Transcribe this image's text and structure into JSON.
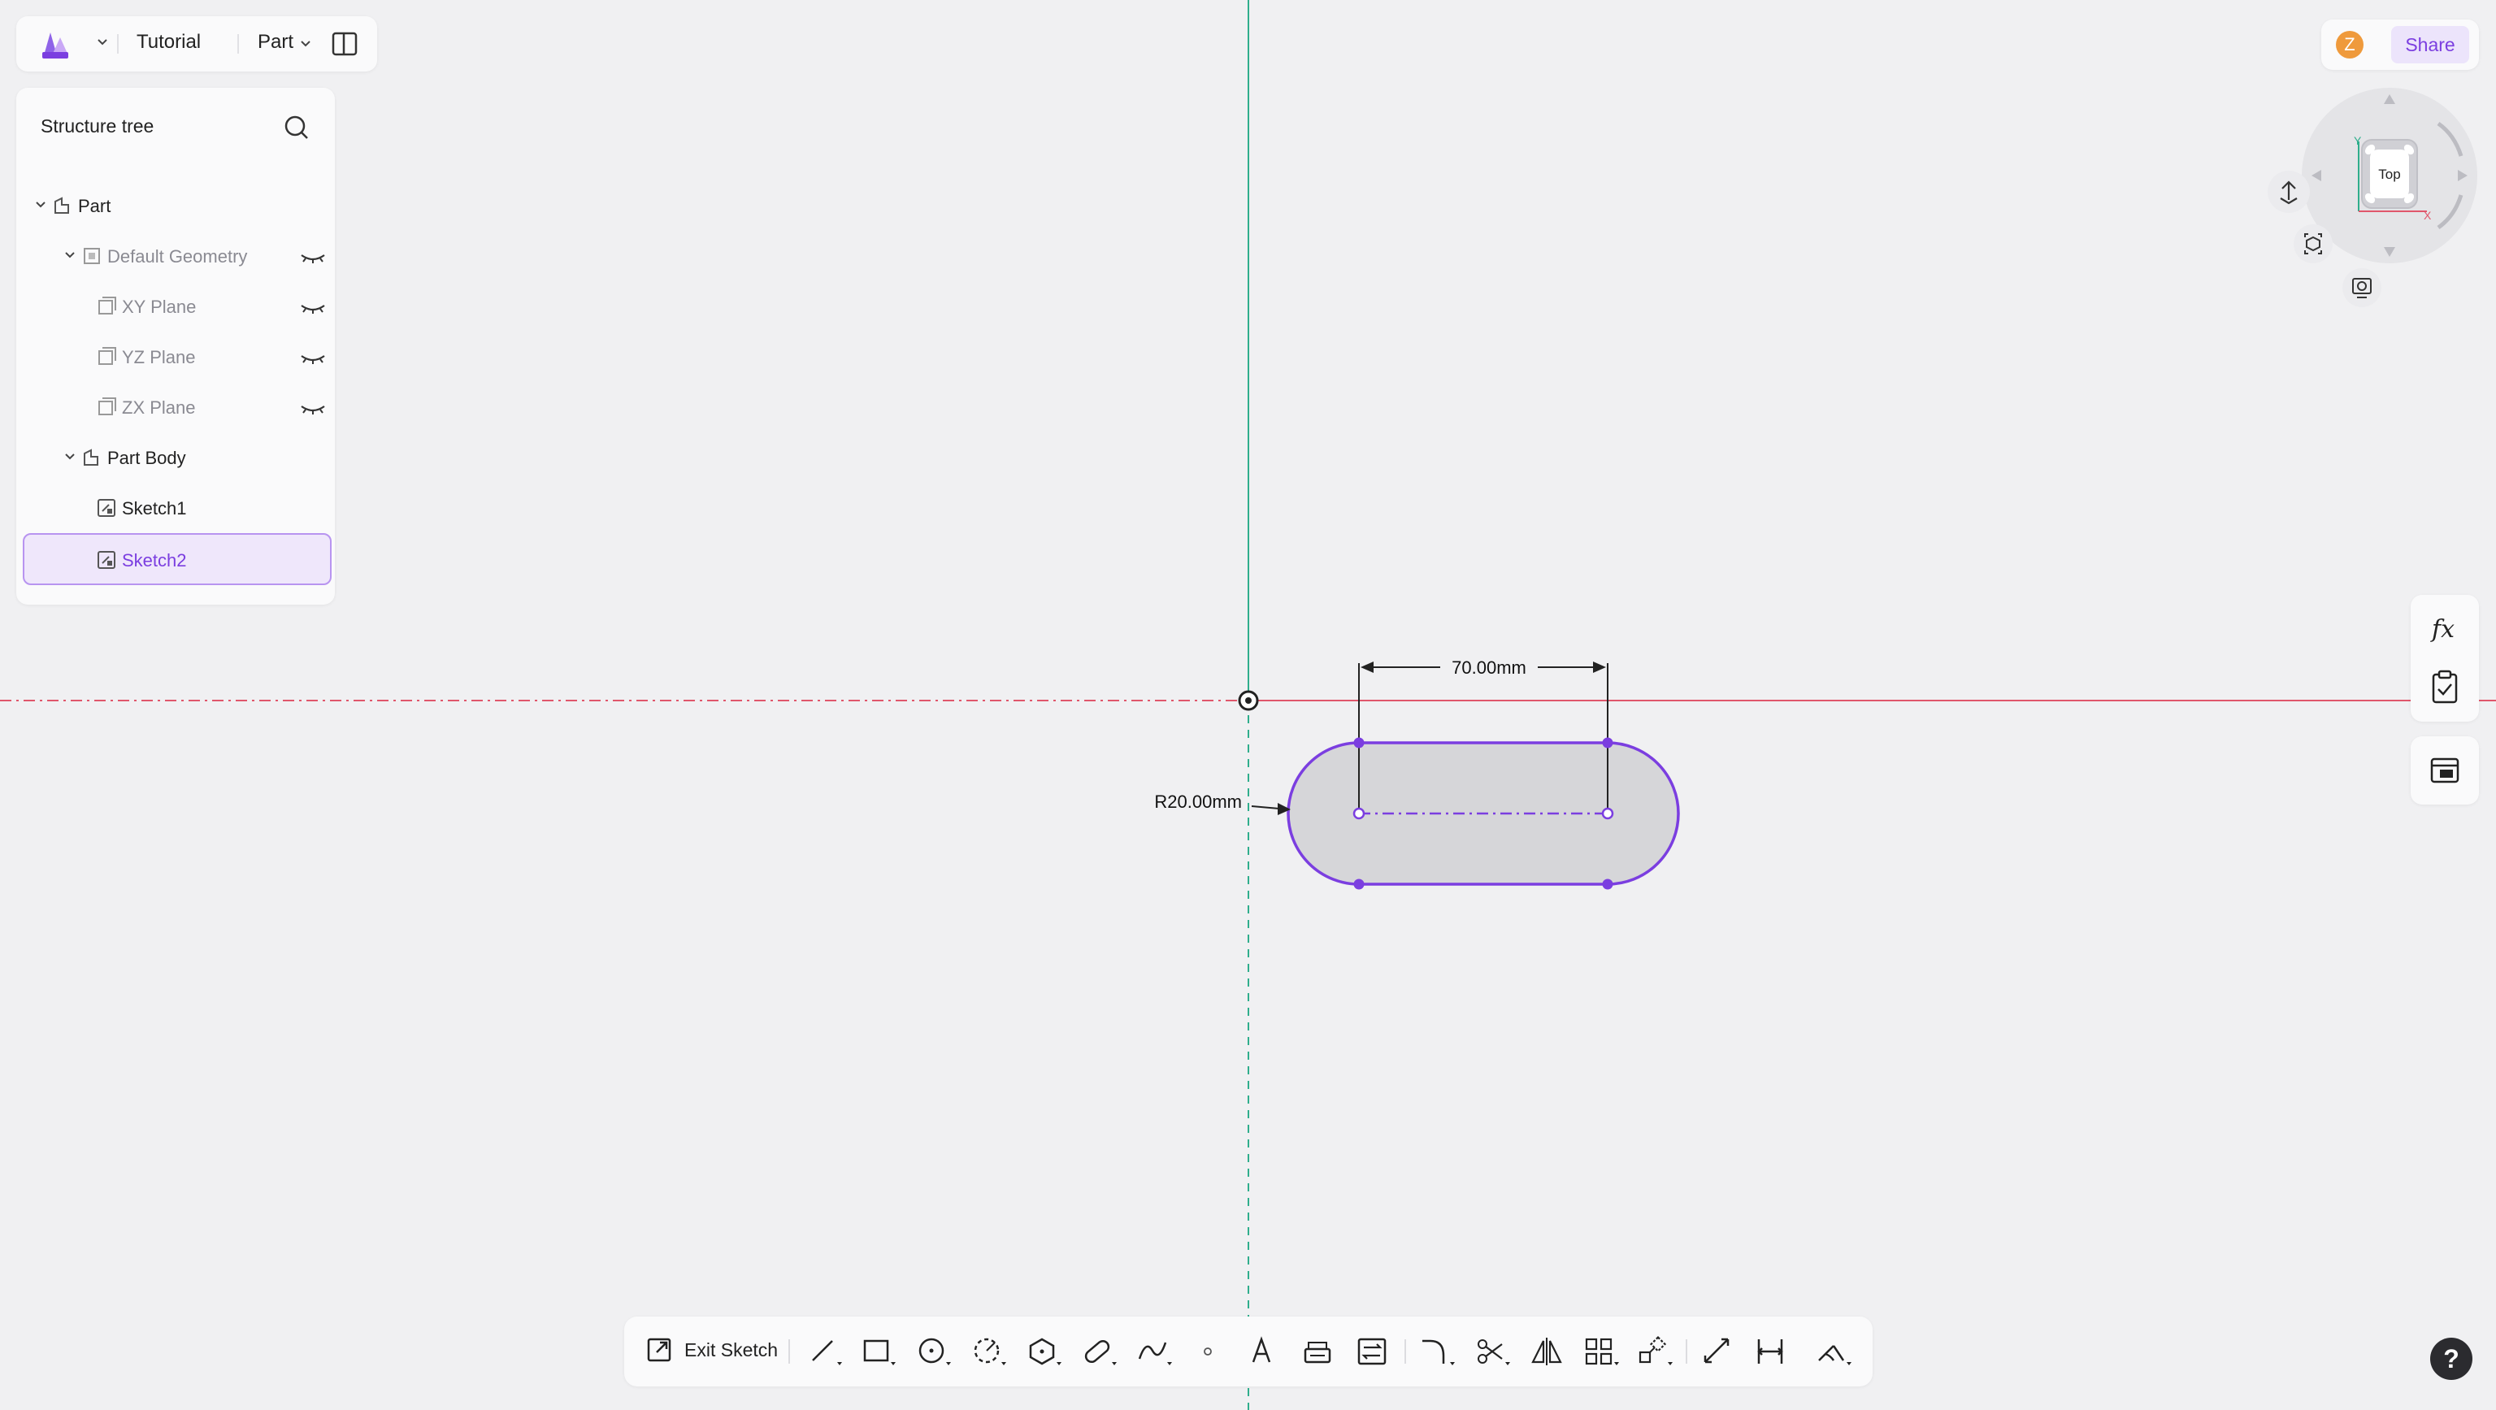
{
  "app": {
    "document_title": "Tutorial",
    "mode": "Part"
  },
  "share": {
    "avatar_initial": "Z",
    "share_label": "Share"
  },
  "tree": {
    "header": "Structure tree",
    "items": [
      {
        "label": "Part",
        "icon": "part-icon"
      },
      {
        "label": "Default Geometry",
        "icon": "geometry-icon"
      },
      {
        "label": "XY Plane",
        "icon": "plane-icon"
      },
      {
        "label": "YZ Plane",
        "icon": "plane-icon"
      },
      {
        "label": "ZX Plane",
        "icon": "plane-icon"
      },
      {
        "label": "Part Body",
        "icon": "body-icon"
      },
      {
        "label": "Sketch1",
        "icon": "sketch-icon"
      },
      {
        "label": "Sketch2",
        "icon": "sketch-icon"
      }
    ]
  },
  "viewcube": {
    "face_label": "Top",
    "axis_x": "X",
    "axis_y": "Y"
  },
  "sketch": {
    "length_dimension": "70.00mm",
    "radius_dimension": "R20.00mm"
  },
  "toolbar": {
    "exit_label": "Exit Sketch",
    "tools": [
      "line-tool-icon",
      "rectangle-tool-icon",
      "circle-tool-icon",
      "arc-tool-icon",
      "polygon-tool-icon",
      "slot-tool-icon",
      "spline-tool-icon",
      "point-tool-icon",
      "text-tool-icon",
      "project-tool-icon",
      "convert-tool-icon",
      "fillet-tool-icon",
      "trim-tool-icon",
      "mirror-tool-icon",
      "pattern-tool-icon",
      "transform-tool-icon",
      "dimension-tool-icon",
      "constraint-tool-icon",
      "measure-tool-icon"
    ]
  },
  "help_label": "?",
  "colors": {
    "accent": "#7b3ee0",
    "x_axis": "#e0566b",
    "y_axis": "#2fae8c",
    "slot_fill": "#d6d6d9"
  }
}
